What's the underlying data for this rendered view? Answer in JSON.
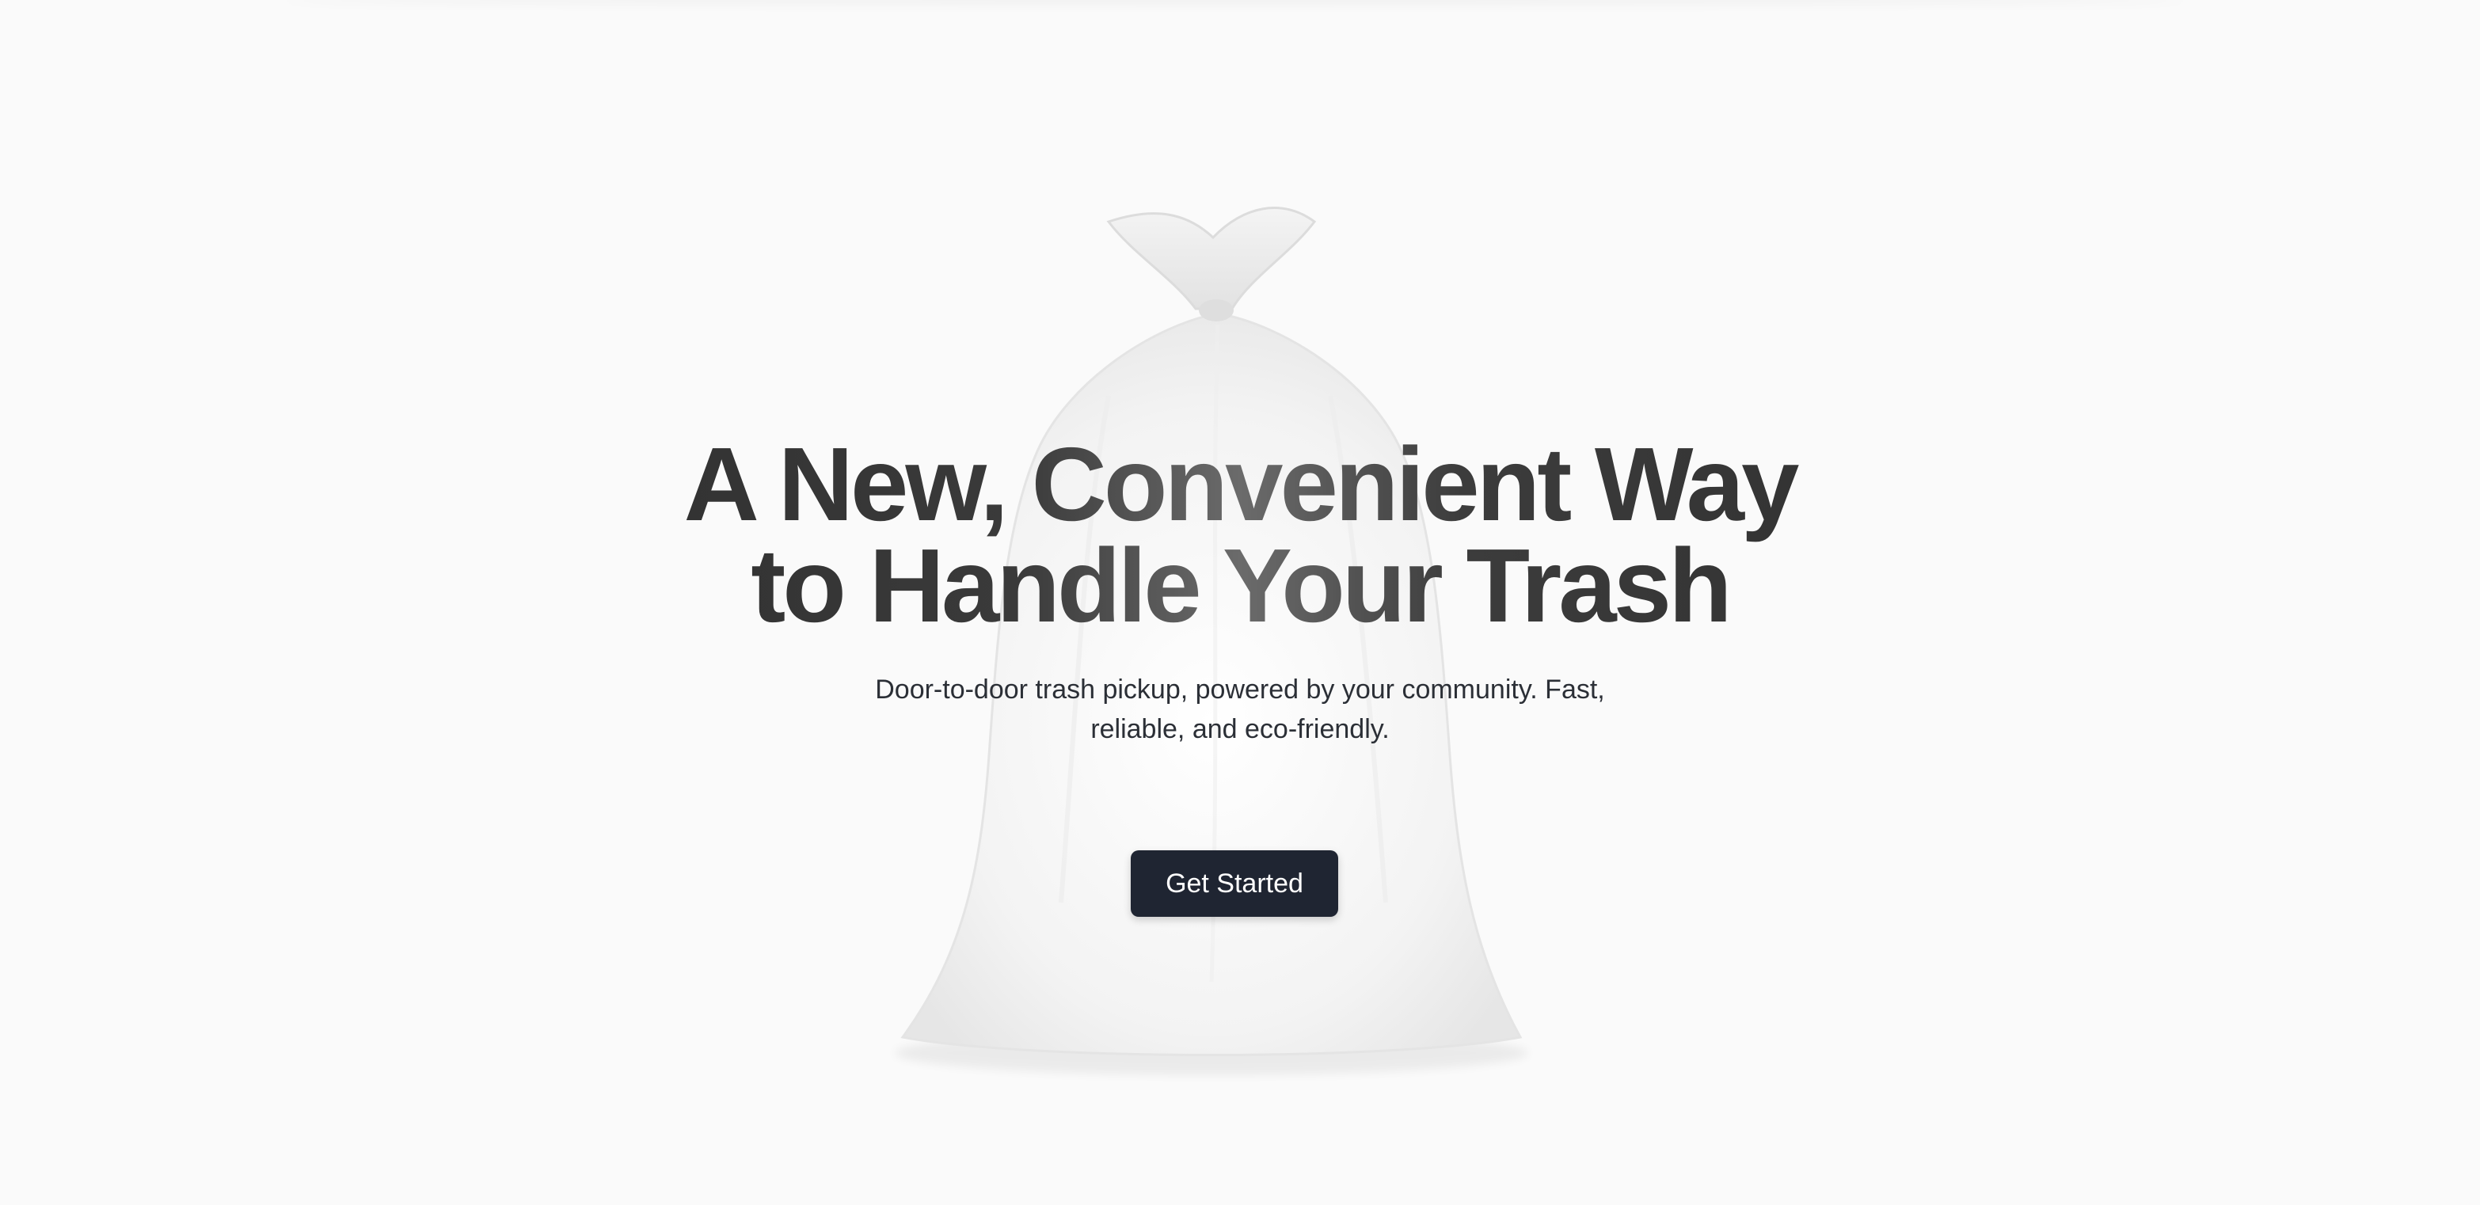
{
  "hero": {
    "headline_line1": "A New, Convenient Way",
    "headline_line2": "to Handle Your Trash",
    "subtitle_line1": "Door-to-door trash pickup, powered by your community. Fast,",
    "subtitle_line2": "reliable, and eco-friendly.",
    "cta_label": "Get Started",
    "background_image": "trash-bag-illustration"
  },
  "colors": {
    "background": "#fafafa",
    "headline_dark": "#2e2e2e",
    "headline_light": "#6b6b6b",
    "subtitle": "#2b2f36",
    "button_bg": "#1f2532",
    "button_text": "#ffffff"
  }
}
